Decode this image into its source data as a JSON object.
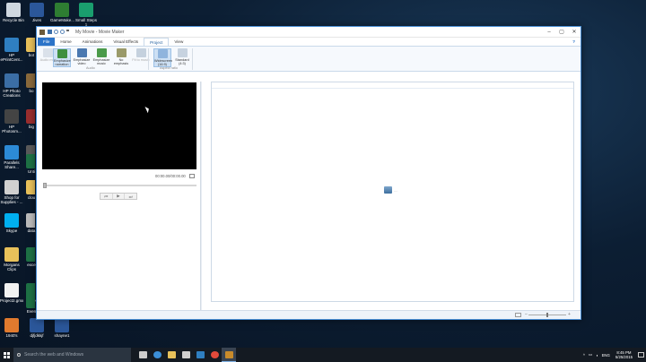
{
  "desktop": {
    "icons": [
      {
        "label": "Recycle Bin",
        "icon": "recycle-bin-icon",
        "color": "#cfd8e0"
      },
      {
        "label": "Jives",
        "icon": "word-doc-icon",
        "color": "#2b579a"
      },
      {
        "label": "GameMake...",
        "icon": "gamemaker-icon",
        "color": "#2e7d32"
      },
      {
        "label": "Small Steps 1",
        "icon": "publisher-icon",
        "color": "#1a9e6e"
      },
      {
        "label": "HP ePrintCent...",
        "icon": "hp-eprint-icon",
        "color": "#2f7fc1"
      },
      {
        "label": "HP Photo Creations",
        "icon": "hp-photo-icon",
        "color": "#3b6ea5"
      },
      {
        "label": "HP Photosm...",
        "icon": "hp-photosmart-icon",
        "color": "#444444"
      },
      {
        "label": "Parallels Share...",
        "icon": "parallels-icon",
        "color": "#2c8ad6"
      },
      {
        "label": "Shop for Supplies - ...",
        "icon": "printer-icon",
        "color": "#d0d0d0"
      },
      {
        "label": "Skype",
        "icon": "skype-icon",
        "color": "#00aff0"
      },
      {
        "label": "Morgans Clips",
        "icon": "folder-icon",
        "color": "#e8c15a"
      },
      {
        "label": "Project2.gmx",
        "icon": "gmx-file-icon",
        "color": "#f2f2f2"
      },
      {
        "label": "1940's",
        "icon": "image-file-icon",
        "color": "#e07a2e"
      },
      {
        "label": "djfjdkkjf",
        "icon": "word-doc-icon",
        "color": "#2b579a"
      },
      {
        "label": "shayne1",
        "icon": "word-doc-icon",
        "color": "#2b579a"
      },
      {
        "label": "bot",
        "icon": "folder-icon",
        "color": "#e8c15a"
      },
      {
        "label": "bo",
        "icon": "image-file-icon",
        "color": "#8a6a3c"
      },
      {
        "label": "big",
        "icon": "image-file-icon",
        "color": "#9a2e2e"
      },
      {
        "label": "big",
        "icon": "image-file-icon",
        "color": "#5a5a5a"
      },
      {
        "label": "Unti",
        "icon": "excel-icon",
        "color": "#1e7145"
      },
      {
        "label": "clou",
        "icon": "folder-icon",
        "color": "#e8c15a"
      },
      {
        "label": "data",
        "icon": "file-icon",
        "color": "#bbbbbb"
      },
      {
        "label": "exce",
        "icon": "excel-icon",
        "color": "#1e7145"
      },
      {
        "label": "exce",
        "icon": "excel-icon",
        "color": "#1e7145"
      },
      {
        "label": "Even",
        "icon": "excel-icon",
        "color": "#1e7145"
      }
    ]
  },
  "window": {
    "title": "My Movie - Movie Maker",
    "tabs": [
      "File",
      "Home",
      "Animations",
      "Visual Effects",
      "Project",
      "View"
    ],
    "active_tab": "Project",
    "ribbon": {
      "audio_group": "Audio",
      "aspect_group": "Aspect ratio",
      "buttons": [
        {
          "label": "Audio mix",
          "icon": "audio-mix-icon",
          "state": "dim"
        },
        {
          "label": "Emphasize narration",
          "icon": "emphasize-narration-icon",
          "state": "selected"
        },
        {
          "label": "Emphasize video",
          "icon": "emphasize-video-icon",
          "state": "normal"
        },
        {
          "label": "Emphasize music",
          "icon": "emphasize-music-icon",
          "state": "normal"
        },
        {
          "label": "No emphasis",
          "icon": "no-emphasis-icon",
          "state": "normal"
        },
        {
          "label": "Fit to music",
          "icon": "fit-to-music-icon",
          "state": "dim"
        },
        {
          "label": "Widescreen (16:9)",
          "icon": "widescreen-icon",
          "state": "selected"
        },
        {
          "label": "Standard (4:3)",
          "icon": "standard-icon",
          "state": "normal"
        }
      ]
    },
    "preview": {
      "timecode": "00:00.00/00:00.00",
      "seek_position": 0.0,
      "controls": [
        "⏮",
        "▶",
        "⏭"
      ]
    },
    "storyboard": {
      "hint": "...."
    }
  },
  "taskbar": {
    "search_placeholder": "Search the web and Windows",
    "apps": [
      {
        "icon": "task-view-icon",
        "color": "#cccccc"
      },
      {
        "icon": "edge-icon",
        "color": "#3c8fd8"
      },
      {
        "icon": "file-explorer-icon",
        "color": "#e8c15a"
      },
      {
        "icon": "store-icon",
        "color": "#cfcfcf"
      },
      {
        "icon": "mail-icon",
        "color": "#2f7fc1"
      },
      {
        "icon": "chrome-icon",
        "color": "#e24a3b"
      },
      {
        "icon": "movie-maker-icon",
        "color": "#c98b2b"
      }
    ],
    "language": "ENG",
    "time": "8:45 PM",
    "date": "5/25/2015"
  }
}
